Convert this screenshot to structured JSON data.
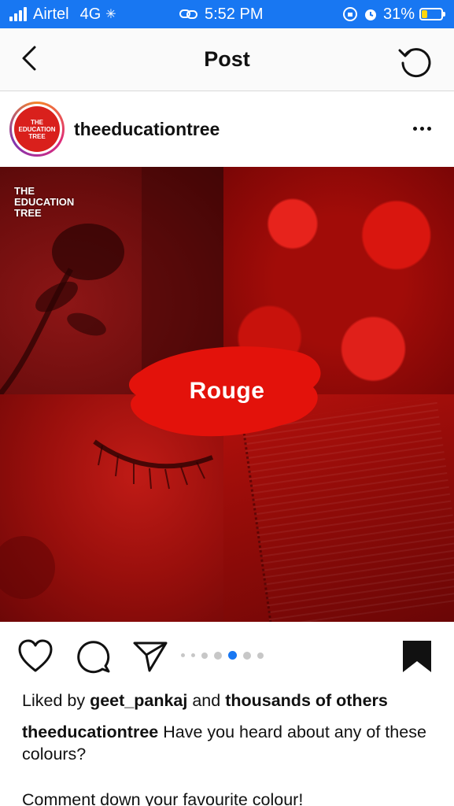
{
  "status_bar": {
    "carrier": "Airtel",
    "network": "4G",
    "time": "5:52 PM",
    "battery_percent": "31%",
    "battery_level": 0.31
  },
  "nav": {
    "title": "Post",
    "back_icon": "chevron-left-icon",
    "refresh_icon": "refresh-icon"
  },
  "post": {
    "username": "theeducationtree",
    "avatar_text": [
      "THE",
      "EDUCATION",
      "TREE"
    ],
    "image_caption_text": "Rouge",
    "watermark": [
      "THE",
      "EDUCATION",
      "TREE"
    ],
    "carousel_total": 7,
    "carousel_active_index": 4
  },
  "caption": {
    "liked_by_prefix": "Liked by",
    "liked_by_user": "geet_pankaj",
    "liked_by_and": "and",
    "liked_by_others": "thousands of others",
    "author": "theeducationtree",
    "text": "Have you heard about any of these colours?",
    "text2": "Comment down your favourite colour!"
  },
  "colors": {
    "status_bar_bg": "#1877f2",
    "accent_dot": "#1877f2",
    "image_red": "#d9201c"
  }
}
